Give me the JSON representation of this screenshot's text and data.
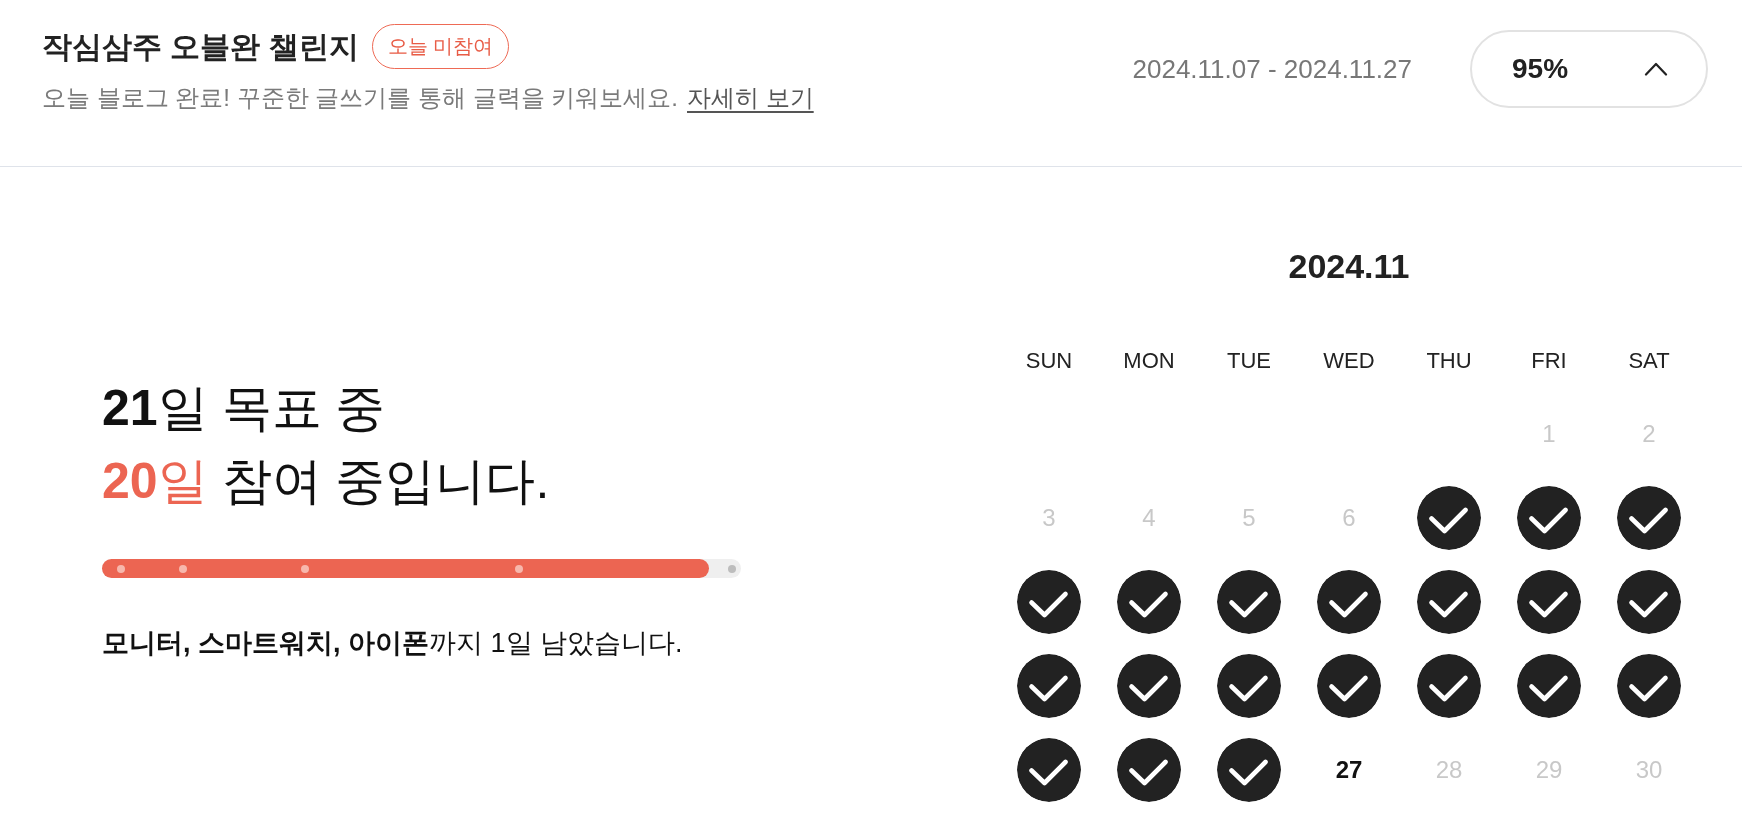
{
  "header": {
    "title": "작심삼주 오블완 챌린지",
    "badge": "오늘 미참여",
    "description": "오늘 블로그 완료! 꾸준한 글쓰기를 통해 글력을 키워보세요.",
    "link": "자세히 보기",
    "period": "2024.11.07 - 2024.11.27",
    "progress_button": {
      "label": "95%",
      "expanded": true
    }
  },
  "summary": {
    "goal_line": "**21**일 목표 중",
    "participated": "**20**일",
    "participated_rest": "참여 중입니다.",
    "progress": {
      "level": 0.95,
      "milestones": [
        {
          "level": 0.03,
          "reached": true
        },
        {
          "level": 0.126,
          "reached": true
        },
        {
          "level": 0.317,
          "reached": true
        },
        {
          "level": 0.653,
          "reached": true
        },
        {
          "level": 0.986,
          "reached": false
        }
      ]
    },
    "reward_note": "**모니터, 스마트워치, 아이폰**까지 1일 남았습니다."
  },
  "calendar": {
    "title": "2024.11",
    "weekdays": [
      "SUN",
      "MON",
      "TUE",
      "WED",
      "THU",
      "FRI",
      "SAT"
    ],
    "weeks": [
      [
        {
          "kind": "blank"
        },
        {
          "kind": "blank"
        },
        {
          "kind": "blank"
        },
        {
          "kind": "blank"
        },
        {
          "kind": "blank"
        },
        {
          "kind": "day",
          "label": "1",
          "checked": false,
          "today": false
        },
        {
          "kind": "day",
          "label": "2",
          "checked": false,
          "today": false
        }
      ],
      [
        {
          "kind": "day",
          "label": "3",
          "checked": false,
          "today": false
        },
        {
          "kind": "day",
          "label": "4",
          "checked": false,
          "today": false
        },
        {
          "kind": "day",
          "label": "5",
          "checked": false,
          "today": false
        },
        {
          "kind": "day",
          "label": "6",
          "checked": false,
          "today": false
        },
        {
          "kind": "day",
          "checked": true,
          "today": false
        },
        {
          "kind": "day",
          "checked": true,
          "today": false
        },
        {
          "kind": "day",
          "checked": true,
          "today": false
        }
      ],
      [
        {
          "kind": "day",
          "checked": true,
          "today": false
        },
        {
          "kind": "day",
          "checked": true,
          "today": false
        },
        {
          "kind": "day",
          "checked": true,
          "today": false
        },
        {
          "kind": "day",
          "checked": true,
          "today": false
        },
        {
          "kind": "day",
          "checked": true,
          "today": false
        },
        {
          "kind": "day",
          "checked": true,
          "today": false
        },
        {
          "kind": "day",
          "checked": true,
          "today": false
        }
      ],
      [
        {
          "kind": "day",
          "checked": true,
          "today": false
        },
        {
          "kind": "day",
          "checked": true,
          "today": false
        },
        {
          "kind": "day",
          "checked": true,
          "today": false
        },
        {
          "kind": "day",
          "checked": true,
          "today": false
        },
        {
          "kind": "day",
          "checked": true,
          "today": false
        },
        {
          "kind": "day",
          "checked": true,
          "today": false
        },
        {
          "kind": "day",
          "checked": true,
          "today": false
        }
      ],
      [
        {
          "kind": "day",
          "checked": true,
          "today": false
        },
        {
          "kind": "day",
          "checked": true,
          "today": false
        },
        {
          "kind": "day",
          "checked": true,
          "today": false
        },
        {
          "kind": "day",
          "label": "27",
          "checked": false,
          "today": true
        },
        {
          "kind": "day",
          "label": "28",
          "checked": false,
          "today": false
        },
        {
          "kind": "day",
          "label": "29",
          "checked": false,
          "today": false
        },
        {
          "kind": "day",
          "label": "30",
          "checked": false,
          "today": false
        }
      ]
    ]
  }
}
